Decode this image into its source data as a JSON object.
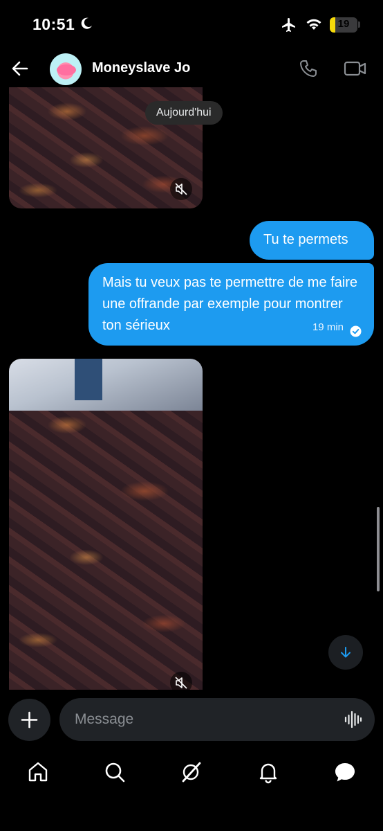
{
  "status": {
    "time": "10:51",
    "battery": "19",
    "battery_level_percent": 19
  },
  "header": {
    "back_icon": "arrow-left-icon",
    "contact_name": "Moneyslave Jo",
    "call_icon": "phone-icon",
    "video_icon": "video-camera-icon"
  },
  "conversation": {
    "date_separator": "Aujourd'hui",
    "messages": [
      {
        "type": "video",
        "sender": "contact",
        "muted": true
      },
      {
        "type": "text",
        "sender": "me",
        "text": "Tu te permets"
      },
      {
        "type": "text",
        "sender": "me",
        "text": "Mais tu veux pas te permettre de me faire une offrande par exemple pour montrer ton sérieux",
        "time": "19 min",
        "read": true
      },
      {
        "type": "video",
        "sender": "contact",
        "muted": true
      }
    ]
  },
  "composer": {
    "placeholder": "Message",
    "add_icon": "plus-icon",
    "voice_icon": "voice-waveform-icon"
  },
  "nav": {
    "items": [
      "home-icon",
      "search-icon",
      "grok-icon",
      "notifications-bell-icon",
      "messages-icon"
    ],
    "active": "messages-icon"
  },
  "colors": {
    "accent": "#1d9bf0",
    "background": "#000000",
    "battery": "#f5d90a"
  }
}
